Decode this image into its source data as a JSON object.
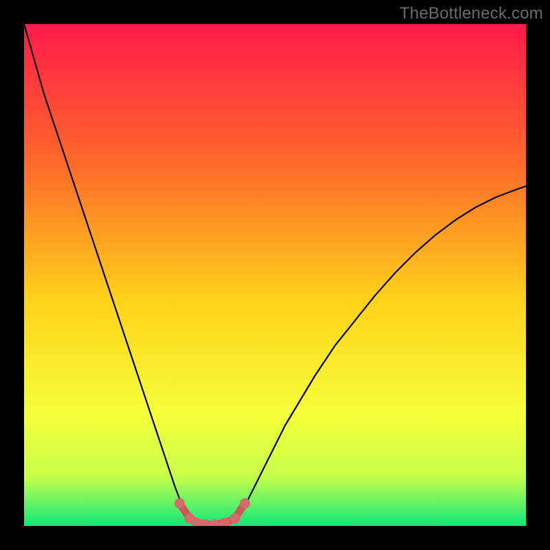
{
  "watermark": "TheBottleneck.com",
  "colors": {
    "background": "#000000",
    "grad_top": "#ff1a4a",
    "grad_mid1": "#ff6a2a",
    "grad_mid2": "#ffd21a",
    "grad_mid3": "#f5ff3a",
    "grad_mid4": "#c8ff4a",
    "grad_bottom": "#10e87a",
    "curve": "#000000",
    "marker_fill": "#d46a6a",
    "marker_stroke": "#c85a5a"
  },
  "chart_data": {
    "type": "line",
    "title": "",
    "xlabel": "",
    "ylabel": "",
    "xlim": [
      0,
      100
    ],
    "ylim": [
      0,
      100
    ],
    "x": [
      0,
      2,
      4,
      6,
      8,
      10,
      12,
      14,
      16,
      18,
      20,
      22,
      24,
      26,
      28,
      30,
      31.5,
      33,
      34.5,
      36,
      38,
      40,
      42,
      44,
      46,
      48,
      50,
      52,
      55,
      58,
      62,
      66,
      70,
      74,
      78,
      82,
      86,
      90,
      94,
      98,
      100
    ],
    "y": [
      100,
      93,
      86,
      80,
      74,
      68,
      62,
      56,
      50,
      44,
      38,
      32,
      26,
      20,
      14,
      8,
      4,
      1.5,
      0.6,
      0.3,
      0.3,
      0.6,
      1.5,
      4,
      8,
      12,
      16,
      20,
      25,
      30,
      36,
      41,
      46,
      50.5,
      54.5,
      58,
      61,
      63.5,
      65.5,
      67,
      67.7
    ],
    "highlight_band": {
      "x_start": 31,
      "x_end": 44,
      "markers_x": [
        31,
        33,
        34.5,
        36,
        38,
        40,
        42,
        44
      ],
      "markers_y": [
        4.5,
        1.5,
        0.6,
        0.3,
        0.3,
        0.6,
        1.5,
        4.5
      ]
    }
  }
}
